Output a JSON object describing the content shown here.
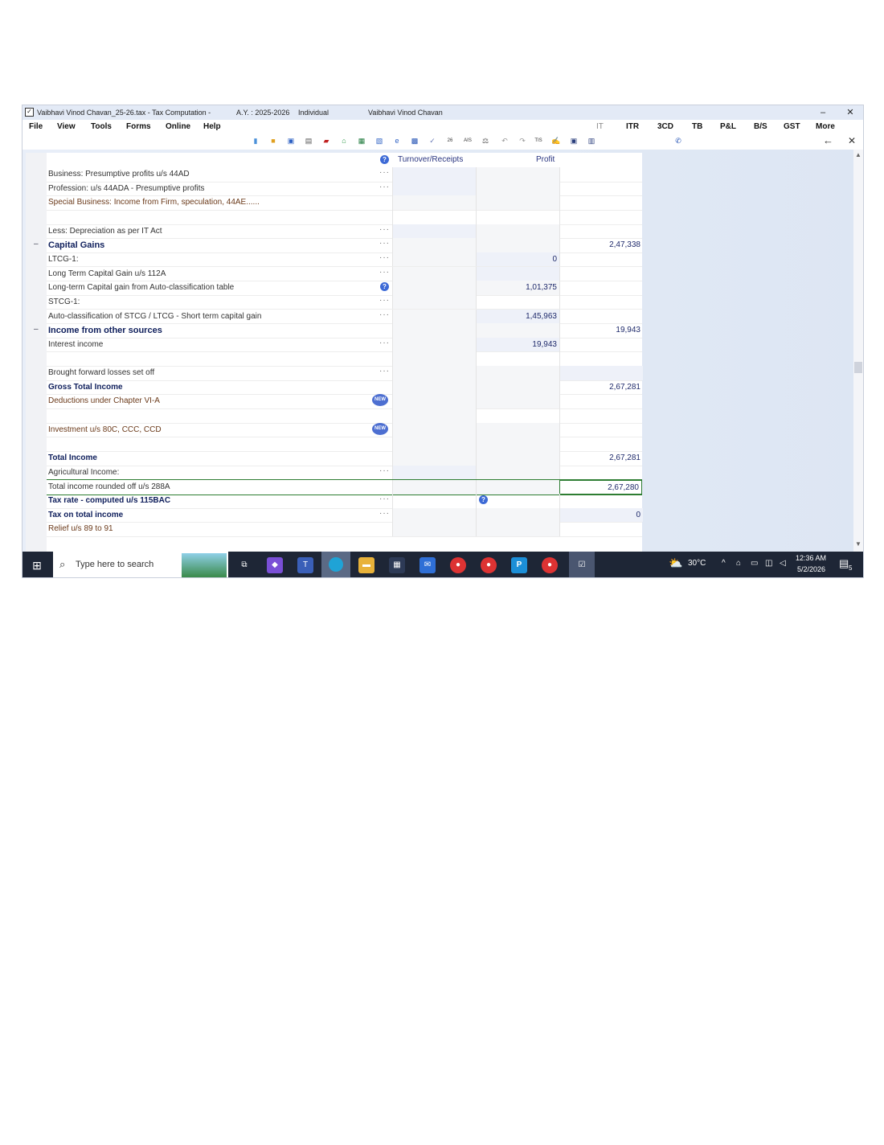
{
  "titlebar": {
    "file": "Vaibhavi Vinod Chavan_25-26.tax - Tax Computation -",
    "ay": "A.Y. : 2025-2026",
    "status": "Individual",
    "name": "Vaibhavi Vinod Chavan"
  },
  "menu": [
    "File",
    "View",
    "Tools",
    "Forms",
    "Online",
    "Help"
  ],
  "nav": [
    "IT",
    "ITR",
    "3CD",
    "TB",
    "P&L",
    "B/S",
    "GST",
    "More"
  ],
  "headers": {
    "turnover": "Turnover/Receipts",
    "profit": "Profit"
  },
  "rows": [
    {
      "label": "Business: Presumptive profits u/s 44AD",
      "style": "",
      "col2": "",
      "col3": ""
    },
    {
      "label": "Profession: u/s 44ADA - Presumptive profits",
      "style": "",
      "col2": "",
      "col3": ""
    },
    {
      "label": "Special Business: Income from Firm, speculation, 44AE......",
      "style": "brown",
      "col2": "",
      "col3": ""
    },
    {
      "label": "",
      "style": "",
      "col2": "",
      "col3": ""
    },
    {
      "label": "Less: Depreciation as per IT Act",
      "style": "",
      "col2": "",
      "col3": ""
    },
    {
      "label": "Capital Gains",
      "style": "section",
      "col2": "",
      "col3": "2,47,338"
    },
    {
      "label": "LTCG-1:",
      "style": "",
      "col2": "0",
      "col3": ""
    },
    {
      "label": "Long Term Capital Gain u/s 112A",
      "style": "",
      "col2": "",
      "col3": ""
    },
    {
      "label": "Long-term Capital gain from Auto-classification table",
      "style": "",
      "col2": "1,01,375",
      "col3": ""
    },
    {
      "label": "STCG-1:",
      "style": "",
      "col2": "",
      "col3": ""
    },
    {
      "label": "Auto-classification of STCG / LTCG - Short term capital gain",
      "style": "",
      "col2": "1,45,963",
      "col3": ""
    },
    {
      "label": "Income from other sources",
      "style": "section",
      "col2": "",
      "col3": "19,943"
    },
    {
      "label": "Interest income",
      "style": "",
      "col2": "19,943",
      "col3": ""
    },
    {
      "label": "",
      "style": "",
      "col2": "",
      "col3": ""
    },
    {
      "label": "Brought forward losses set off",
      "style": "",
      "col2": "",
      "col3": ""
    },
    {
      "label": "Gross Total Income",
      "style": "bold",
      "col2": "",
      "col3": "2,67,281"
    },
    {
      "label": "Deductions under Chapter VI-A",
      "style": "brown",
      "col2": "",
      "col3": ""
    },
    {
      "label": "",
      "style": "",
      "col2": "",
      "col3": ""
    },
    {
      "label": "Investment u/s 80C, CCC, CCD",
      "style": "brown",
      "col2": "",
      "col3": ""
    },
    {
      "label": "",
      "style": "",
      "col2": "",
      "col3": ""
    },
    {
      "label": "Total Income",
      "style": "bold",
      "col2": "",
      "col3": "2,67,281"
    },
    {
      "label": "Agricultural Income:",
      "style": "",
      "col2": "",
      "col3": ""
    },
    {
      "label": "Total income rounded off u/s 288A",
      "style": "",
      "col2": "",
      "col3": "2,67,280"
    },
    {
      "label": "Tax rate   -   computed u/s 115BAC",
      "style": "bold",
      "col2": "",
      "col3": ""
    },
    {
      "label": "Tax on total income",
      "style": "bold",
      "col2": "",
      "col3": "0"
    },
    {
      "label": "Relief u/s 89 to 91",
      "style": "brown",
      "col2": "",
      "col3": ""
    }
  ],
  "taskbar": {
    "search_placeholder": "Type here to search",
    "temperature": "30°C",
    "time": "12:36 AM",
    "date": "5/2/2026",
    "notifications": "5"
  }
}
